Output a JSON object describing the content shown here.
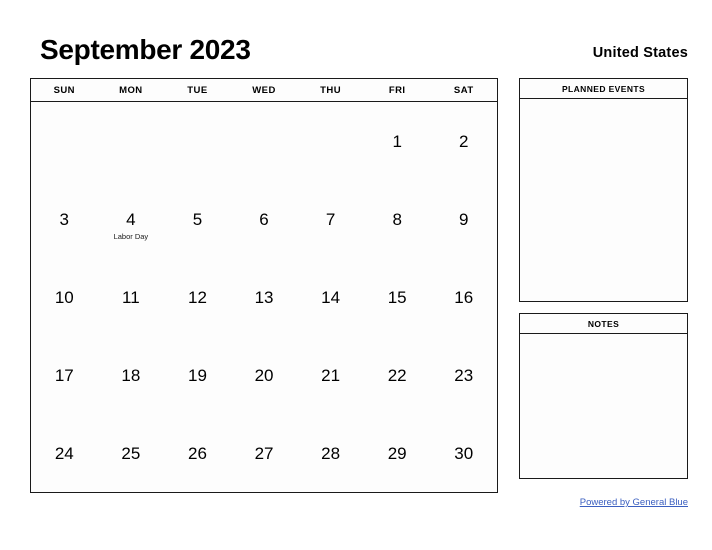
{
  "header": {
    "title": "September 2023",
    "region": "United States"
  },
  "calendar": {
    "weekdays": [
      "SUN",
      "MON",
      "TUE",
      "WED",
      "THU",
      "FRI",
      "SAT"
    ],
    "weeks": [
      [
        {
          "day": "",
          "event": ""
        },
        {
          "day": "",
          "event": ""
        },
        {
          "day": "",
          "event": ""
        },
        {
          "day": "",
          "event": ""
        },
        {
          "day": "",
          "event": ""
        },
        {
          "day": "1",
          "event": ""
        },
        {
          "day": "2",
          "event": ""
        }
      ],
      [
        {
          "day": "3",
          "event": ""
        },
        {
          "day": "4",
          "event": "Labor Day"
        },
        {
          "day": "5",
          "event": ""
        },
        {
          "day": "6",
          "event": ""
        },
        {
          "day": "7",
          "event": ""
        },
        {
          "day": "8",
          "event": ""
        },
        {
          "day": "9",
          "event": ""
        }
      ],
      [
        {
          "day": "10",
          "event": ""
        },
        {
          "day": "11",
          "event": ""
        },
        {
          "day": "12",
          "event": ""
        },
        {
          "day": "13",
          "event": ""
        },
        {
          "day": "14",
          "event": ""
        },
        {
          "day": "15",
          "event": ""
        },
        {
          "day": "16",
          "event": ""
        }
      ],
      [
        {
          "day": "17",
          "event": ""
        },
        {
          "day": "18",
          "event": ""
        },
        {
          "day": "19",
          "event": ""
        },
        {
          "day": "20",
          "event": ""
        },
        {
          "day": "21",
          "event": ""
        },
        {
          "day": "22",
          "event": ""
        },
        {
          "day": "23",
          "event": ""
        }
      ],
      [
        {
          "day": "24",
          "event": ""
        },
        {
          "day": "25",
          "event": ""
        },
        {
          "day": "26",
          "event": ""
        },
        {
          "day": "27",
          "event": ""
        },
        {
          "day": "28",
          "event": ""
        },
        {
          "day": "29",
          "event": ""
        },
        {
          "day": "30",
          "event": ""
        }
      ]
    ]
  },
  "panels": {
    "planned_events": {
      "title": "PLANNED EVENTS",
      "content": ""
    },
    "notes": {
      "title": "NOTES",
      "content": ""
    }
  },
  "footer": {
    "link_text": "Powered by General Blue",
    "link_color": "#3b5fc0"
  }
}
